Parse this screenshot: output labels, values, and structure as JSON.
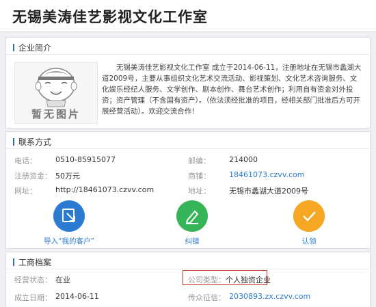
{
  "header": {
    "title": "无锡美涛佳艺影视文化工作室"
  },
  "profile": {
    "section_title": "企业简介",
    "logo_text": "暂无图片",
    "intro": "无锡美涛佳艺影视文化工作室 成立于2014-06-11，注册地址在无锡市蠡湖大道2009号，主要从事组织文化艺术交流活动、影视策划、文化艺术咨询服务、文化娱乐经纪人服务、文学创作、剧本创作、舞台艺术创作；利用自有资金对外投资；资产管理（不含国有资产）。（依法须经批准的项目，经相关部门批准后方可开展经营活动）。欢迎交流合作！"
  },
  "contact": {
    "section_title": "联系方式",
    "phone_label": "电话：",
    "phone": "0510-85915077",
    "postcode_label": "邮编：",
    "postcode": "214000",
    "capital_label": "注册资金：",
    "capital": "50万元",
    "shop_label": "商铺：",
    "shop": "18461073.czvv.com",
    "website_label": "网址：",
    "website": "http://18461073.czvv.com",
    "address_label": "地址：",
    "address": "无锡市蠡湖大道2009号",
    "actions": [
      {
        "label": "导入“我的客户”",
        "icon": "import-icon",
        "color": "#2b7bd3"
      },
      {
        "label": "纠错",
        "icon": "pencil-icon",
        "color": "#35b557"
      },
      {
        "label": "认领",
        "icon": "check-icon",
        "color": "#f5a623"
      }
    ]
  },
  "records": {
    "section_title": "工商档案",
    "status_label": "经营状态：",
    "status": "在业",
    "type_label": "公司类型：",
    "type": "个人独资企业",
    "date_label": "成立日期：",
    "date": "2014-06-11",
    "credit_label": "传众征信：",
    "credit": "2030893.zx.czvv.com"
  }
}
